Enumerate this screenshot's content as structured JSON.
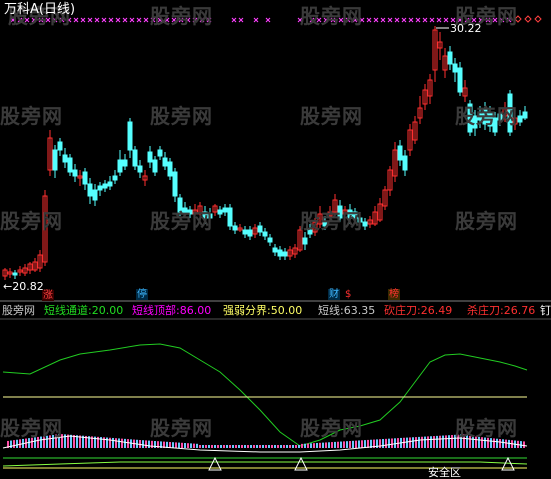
{
  "window": {
    "title": "万科A(日线)",
    "watermark": "股旁网"
  },
  "main_chart": {
    "high_marker": "30.22",
    "low_marker": "←20.82",
    "signal_tags": [
      {
        "text": "涨",
        "color": "#ff4040",
        "bg": "#3a0000"
      },
      {
        "text": "停",
        "color": "#3fb8ff",
        "bg": "#002a44"
      },
      {
        "text": "财",
        "color": "#3fb8ff",
        "bg": "#002a44"
      },
      {
        "text": "$",
        "color": "#ff3030",
        "bg": "#000000"
      },
      {
        "text": "榜",
        "color": "#ff3030",
        "bg": "#3a2a00"
      }
    ],
    "colors": {
      "up": "#ff3030",
      "down": "#55ffff",
      "marker": "#ff40ff"
    }
  },
  "indicator": {
    "name": "股旁网",
    "items": [
      {
        "label": "短线通道:",
        "value": "20.00",
        "color": "#22dd22"
      },
      {
        "label": "短线顶部:",
        "value": "86.00",
        "color": "#ff00ff"
      },
      {
        "label": "强弱分界:",
        "value": "50.00",
        "color": "#ffff66"
      },
      {
        "label": "短线:",
        "value": "63.35",
        "color": "#c8c8c8"
      },
      {
        "label": "砍庄刀:",
        "value": "26.49",
        "color": "#ff3030"
      },
      {
        "label": "杀庄刀:",
        "value": "26.76",
        "color": "#ff3030"
      },
      {
        "label": "钉",
        "value": "",
        "color": "#ffffff"
      }
    ],
    "safe_zone_label": "安全区"
  }
}
